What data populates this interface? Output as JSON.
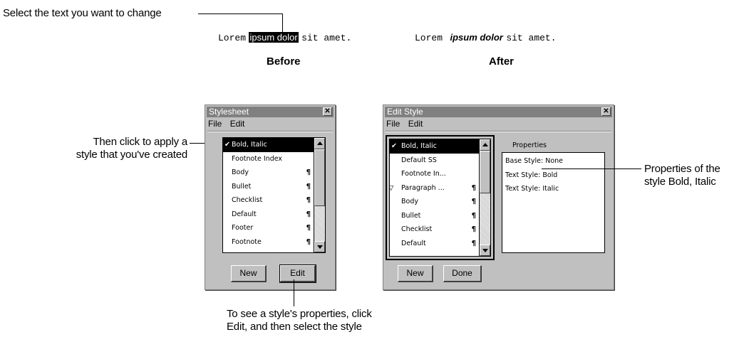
{
  "callouts": {
    "select_text": "Select the text you want to change",
    "apply_style_line1": "Then click to apply a",
    "apply_style_line2": "style that you've created",
    "properties_line1": "Properties of the",
    "properties_line2": "style Bold, Italic",
    "see_props_line1": "To see a style's properties, click",
    "see_props_line2": "Edit, and then select the style"
  },
  "before": {
    "text_start": "Lorem",
    "text_highlight": "ipsum dolor",
    "text_end": "sit amet.",
    "caption": "Before"
  },
  "after": {
    "text_start": "Lorem",
    "text_styled": "ipsum dolor",
    "text_end": "sit amet.",
    "caption": "After"
  },
  "stylesheet_window": {
    "title": "Stylesheet",
    "menu": [
      "File",
      "Edit"
    ],
    "items": [
      {
        "label": "Bold, Italic",
        "selected": true,
        "checked": true,
        "para": ""
      },
      {
        "label": "Footnote Index",
        "selected": false,
        "checked": false,
        "para": ""
      },
      {
        "label": "Body",
        "selected": false,
        "checked": false,
        "para": "¶"
      },
      {
        "label": "Bullet",
        "selected": false,
        "checked": false,
        "para": "¶"
      },
      {
        "label": "Checklist",
        "selected": false,
        "checked": false,
        "para": "¶"
      },
      {
        "label": "Default",
        "selected": false,
        "checked": false,
        "para": "¶"
      },
      {
        "label": "Footer",
        "selected": false,
        "checked": false,
        "para": "¶"
      },
      {
        "label": "Footnote",
        "selected": false,
        "checked": false,
        "para": "¶"
      }
    ],
    "buttons": {
      "new": "New",
      "edit": "Edit"
    }
  },
  "edit_style_window": {
    "title": "Edit Style",
    "menu": [
      "File",
      "Edit"
    ],
    "items": [
      {
        "label": "Bold, Italic",
        "selected": true,
        "checked": true,
        "expand": "",
        "para": ""
      },
      {
        "label": "Default SS",
        "selected": false,
        "checked": false,
        "expand": "",
        "para": ""
      },
      {
        "label": "Footnote In...",
        "selected": false,
        "checked": false,
        "expand": "",
        "para": ""
      },
      {
        "label": "Paragraph ...",
        "selected": false,
        "checked": false,
        "expand": "▽",
        "para": "¶"
      },
      {
        "label": "Body",
        "selected": false,
        "checked": false,
        "expand": "",
        "para": "¶"
      },
      {
        "label": "Bullet",
        "selected": false,
        "checked": false,
        "expand": "",
        "para": "¶"
      },
      {
        "label": "Checklist",
        "selected": false,
        "checked": false,
        "expand": "",
        "para": "¶"
      },
      {
        "label": "Default",
        "selected": false,
        "checked": false,
        "expand": "",
        "para": "¶"
      }
    ],
    "properties_title": "Properties",
    "properties": [
      "Base Style: None",
      "Text Style: Bold",
      "Text Style: Italic"
    ],
    "buttons": {
      "new": "New",
      "done": "Done"
    }
  },
  "colors": {
    "window_face": "#c0c0c0",
    "titlebar": "#808080",
    "selection": "#000000"
  },
  "icons": {
    "close": "close-icon",
    "check": "checkmark-icon",
    "paragraph": "paragraph-mark-icon",
    "expand": "expand-triangle-icon"
  }
}
